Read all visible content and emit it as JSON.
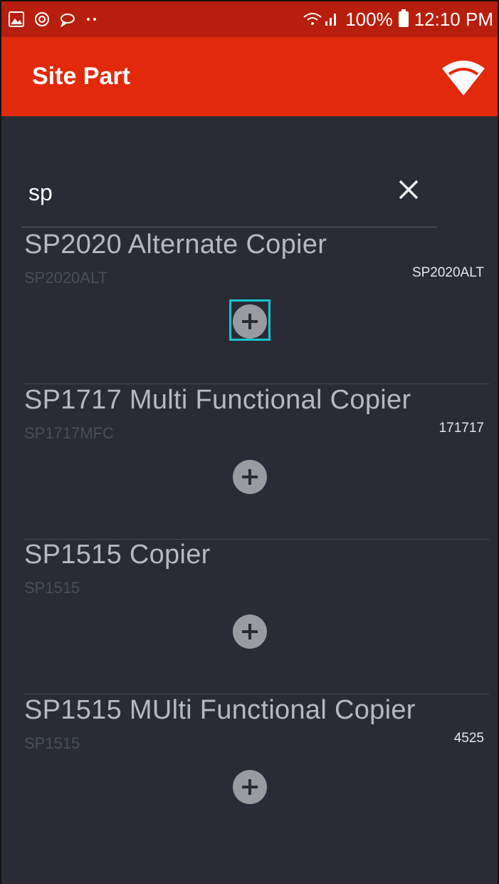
{
  "status_bar": {
    "left_icons": [
      "gallery-icon",
      "sync-icon",
      "chat-bubble-icon",
      "more-dots-icon"
    ],
    "signal": "wifi-signal-icon",
    "battery_percent": "100%",
    "time": "12:10 PM"
  },
  "app_bar": {
    "title": "Site Part",
    "action_icon": "wifi-icon",
    "color": "#e2290b"
  },
  "search": {
    "value": "sp"
  },
  "items": [
    {
      "name": "SP2020 Alternate Copier",
      "code": "SP2020ALT",
      "number": "SP2020ALT"
    },
    {
      "name": "SP1717 Multi Functional Copier",
      "code": "SP1717MFC",
      "number": "171717"
    },
    {
      "name": "SP1515 Copier",
      "code": "SP1515",
      "number": ""
    },
    {
      "name": "SP1515 MUlti Functional Copier",
      "code": "SP1515",
      "number": "4525"
    }
  ],
  "colors": {
    "accent_focus": "#18c4cf",
    "background": "#292c35"
  }
}
